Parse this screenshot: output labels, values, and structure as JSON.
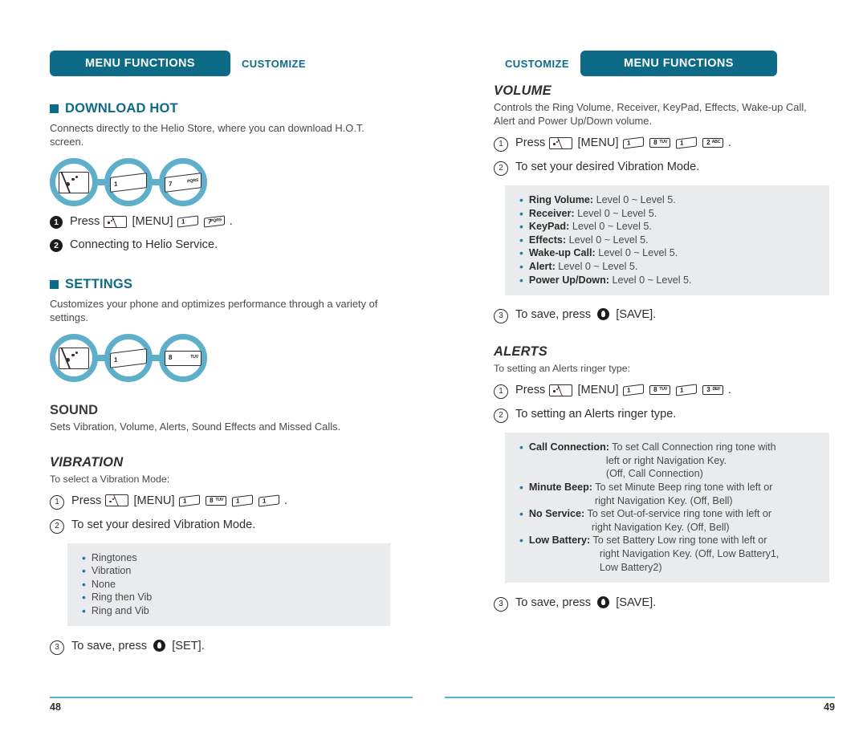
{
  "left_page": {
    "header": {
      "tab_label": "MENU FUNCTIONS",
      "breadcrumb": "CUSTOMIZE"
    },
    "download_hot": {
      "title": "DOWNLOAD HOT",
      "body": "Connects directly to the Helio Store, where you can download H.O.T. screen.",
      "icon_chain": [
        {
          "name": "menu-key-icon",
          "type": "navkey"
        },
        {
          "name": "key-1-icon",
          "digit": "1",
          "letters": ""
        },
        {
          "name": "key-7-icon",
          "digit": "7",
          "letters": "PQRS"
        }
      ],
      "steps": [
        {
          "marker": "1",
          "style": "filled",
          "press_label": "Press",
          "keys": [
            "MENU",
            "1",
            "7"
          ],
          "trailing": "."
        },
        {
          "marker": "2",
          "style": "filled",
          "text": "Connecting to Helio Service."
        }
      ]
    },
    "settings": {
      "title": "SETTINGS",
      "body": "Customizes your phone and optimizes performance through a variety of settings.",
      "icon_chain": [
        {
          "name": "menu-key-icon",
          "type": "navkey"
        },
        {
          "name": "key-1-icon",
          "digit": "1",
          "letters": ""
        },
        {
          "name": "key-8-icon",
          "digit": "8",
          "letters": "TUV"
        }
      ]
    },
    "sound": {
      "title": "SOUND",
      "body": "Sets Vibration, Volume, Alerts, Sound Effects and Missed Calls."
    },
    "vibration": {
      "title": "VIBRATION",
      "lead": "To select a Vibration Mode:",
      "steps": [
        {
          "marker": "1",
          "press_label": "Press",
          "keys": [
            "MENU",
            "1",
            "8",
            "1",
            "1"
          ],
          "trailing": "."
        },
        {
          "marker": "2",
          "text": "To set your desired Vibration Mode."
        },
        {
          "marker": "3",
          "text_before": "To save, press",
          "text_after": "[SET]."
        }
      ],
      "options": [
        "Ringtones",
        "Vibration",
        "None",
        "Ring then Vib",
        "Ring and Vib"
      ]
    },
    "page_number": "48"
  },
  "right_page": {
    "header": {
      "tab_label": "MENU FUNCTIONS",
      "breadcrumb": "CUSTOMIZE"
    },
    "volume": {
      "title": "VOLUME",
      "body": "Controls the Ring Volume, Receiver, KeyPad, Effects, Wake-up Call, Alert and Power Up/Down volume.",
      "steps": [
        {
          "marker": "1",
          "press_label": "Press",
          "keys": [
            "MENU",
            "1",
            "8",
            "1",
            "2"
          ],
          "trailing": "."
        },
        {
          "marker": "2",
          "text": "To set your desired Vibration Mode."
        },
        {
          "marker": "3",
          "text_before": "To save, press",
          "text_after": "[SAVE]."
        }
      ],
      "options": [
        {
          "label": "Ring Volume:",
          "value": "Level 0 ~ Level 5."
        },
        {
          "label": "Receiver:",
          "value": "Level 0 ~ Level 5."
        },
        {
          "label": "KeyPad:",
          "value": "Level 0 ~ Level 5."
        },
        {
          "label": "Effects:",
          "value": "Level 0 ~ Level 5."
        },
        {
          "label": "Wake-up Call:",
          "value": "Level 0 ~ Level 5."
        },
        {
          "label": "Alert:",
          "value": "Level 0 ~ Level 5."
        },
        {
          "label": "Power Up/Down:",
          "value": "Level 0 ~ Level 5."
        }
      ]
    },
    "alerts": {
      "title": "ALERTS",
      "lead": "To setting an Alerts ringer type:",
      "steps": [
        {
          "marker": "1",
          "press_label": "Press",
          "keys": [
            "MENU",
            "1",
            "8",
            "1",
            "3"
          ],
          "trailing": "."
        },
        {
          "marker": "2",
          "text": "To setting an Alerts ringer type."
        },
        {
          "marker": "3",
          "text_before": "To save, press",
          "text_after": "[SAVE]."
        }
      ],
      "options": [
        {
          "label": "Call Connection:",
          "line1": "To set Call Connection ring tone with",
          "line2": "left or right Navigation Key.",
          "line3": "(Off, Call Connection)"
        },
        {
          "label": "Minute Beep:",
          "line1": "To set Minute Beep ring tone with left or",
          "line2": "right Navigation Key. (Off, Bell)",
          "line3": ""
        },
        {
          "label": "No Service:",
          "line1": "To set Out-of-service ring tone with left or",
          "line2": "right Navigation Key. (Off, Bell)",
          "line3": ""
        },
        {
          "label": "Low Battery:",
          "line1": "To set Battery Low ring tone with left or",
          "line2": "right Navigation Key. (Off, Low Battery1,",
          "line3": "Low Battery2)"
        }
      ]
    },
    "page_number": "49"
  },
  "keys": {
    "menu_bracket": "[MENU]",
    "k1": {
      "digit": "1",
      "letters": ""
    },
    "k2": {
      "digit": "2",
      "letters": "ABC"
    },
    "k3": {
      "digit": "3",
      "letters": "DEF"
    },
    "k7": {
      "digit": "7",
      "letters": "PQRS"
    },
    "k8": {
      "digit": "8",
      "letters": "TUV"
    }
  },
  "colors": {
    "teal": "#0d6b88",
    "light_teal": "#5eafca",
    "bullet": "#1a7fa0",
    "listbox_bg": "#e9ebec",
    "body_text": "#4a4a4a"
  }
}
